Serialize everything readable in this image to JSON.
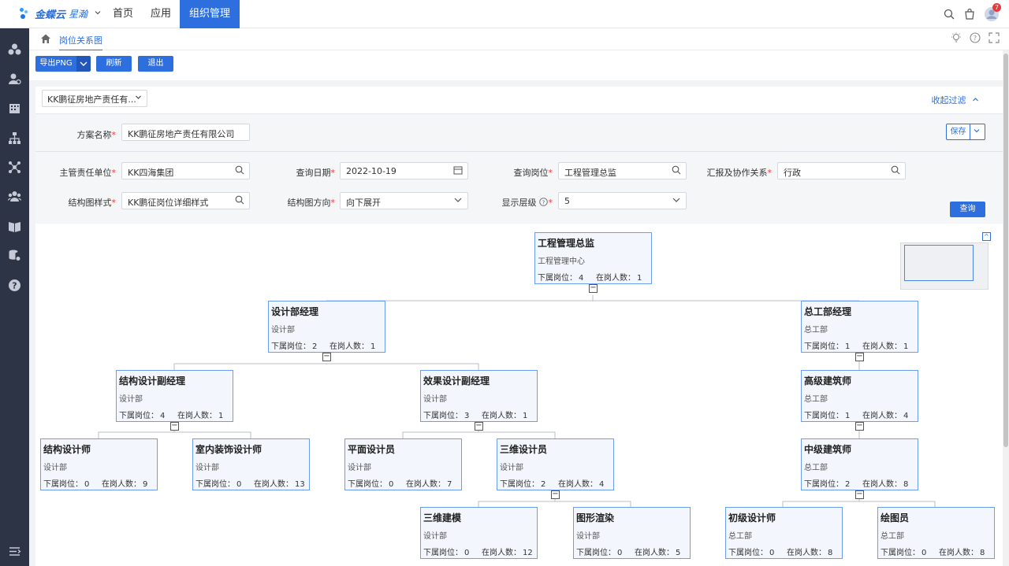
{
  "app": {
    "brand": "金蝶云",
    "brand_sub": "星瀚"
  },
  "nav": {
    "items": [
      "首页",
      "应用",
      "组织管理"
    ],
    "active": "组织管理"
  },
  "notifications": {
    "count": "7"
  },
  "breadcrumb": {
    "title": "岗位关系图"
  },
  "toolbar": {
    "export_label": "导出PNG",
    "refresh_label": "刷新",
    "exit_label": "退出"
  },
  "filter": {
    "scheme_select": "KK鹏征房地产责任有...",
    "collapse_label": "收起过滤",
    "scheme_name_label": "方案名称",
    "scheme_name_value": "KK鹏征房地产责任有限公司",
    "save_label": "保存",
    "unit_label": "主管责任单位",
    "unit_value": "KK四海集团",
    "date_label": "查询日期",
    "date_value": "2022-10-19",
    "position_label": "查询岗位",
    "position_value": "工程管理总监",
    "relation_label": "汇报及协作关系",
    "relation_value": "行政",
    "style_label": "结构图样式",
    "style_value": "KK鹏征岗位详细样式",
    "direction_label": "结构图方向",
    "direction_value": "向下展开",
    "level_label": "显示层级",
    "level_value": "5",
    "query_label": "查询"
  },
  "chart": {
    "sub_label": "下属岗位：",
    "staff_label": "在岗人数：",
    "nodes": [
      {
        "title": "工程管理总监",
        "dept": "工程管理中心",
        "sub": "4",
        "staff": "1"
      },
      {
        "title": "设计部经理",
        "dept": "设计部",
        "sub": "2",
        "staff": "1"
      },
      {
        "title": "总工部经理",
        "dept": "总工部",
        "sub": "1",
        "staff": "1"
      },
      {
        "title": "结构设计副经理",
        "dept": "设计部",
        "sub": "4",
        "staff": "1"
      },
      {
        "title": "效果设计副经理",
        "dept": "设计部",
        "sub": "3",
        "staff": "1"
      },
      {
        "title": "高级建筑师",
        "dept": "总工部",
        "sub": "1",
        "staff": "4"
      },
      {
        "title": "结构设计师",
        "dept": "设计部",
        "sub": "0",
        "staff": "9"
      },
      {
        "title": "室内装饰设计师",
        "dept": "设计部",
        "sub": "0",
        "staff": "13"
      },
      {
        "title": "平面设计员",
        "dept": "设计部",
        "sub": "0",
        "staff": "7"
      },
      {
        "title": "三维设计员",
        "dept": "设计部",
        "sub": "2",
        "staff": "4"
      },
      {
        "title": "中级建筑师",
        "dept": "总工部",
        "sub": "2",
        "staff": "8"
      },
      {
        "title": "三维建模",
        "dept": "设计部",
        "sub": "0",
        "staff": "12"
      },
      {
        "title": "图形渲染",
        "dept": "设计部",
        "sub": "0",
        "staff": "5"
      },
      {
        "title": "初级设计师",
        "dept": "总工部",
        "sub": "0",
        "staff": "8"
      },
      {
        "title": "绘图员",
        "dept": "总工部",
        "sub": "0",
        "staff": "8"
      }
    ]
  }
}
